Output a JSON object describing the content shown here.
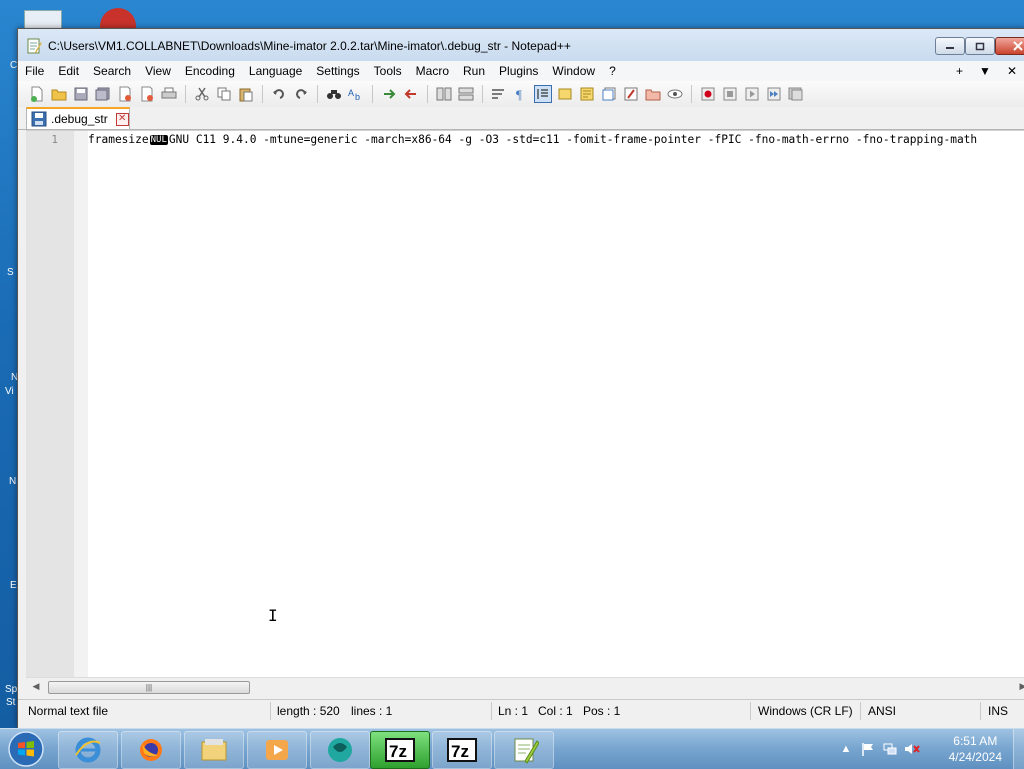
{
  "window": {
    "title": "C:\\Users\\VM1.COLLABNET\\Downloads\\Mine-imator 2.0.2.tar\\Mine-imator\\.debug_str - Notepad++"
  },
  "menu": {
    "items": [
      "File",
      "Edit",
      "Search",
      "View",
      "Encoding",
      "Language",
      "Settings",
      "Tools",
      "Macro",
      "Run",
      "Plugins",
      "Window",
      "?"
    ],
    "right": [
      "+",
      "▼",
      "✕"
    ]
  },
  "tab": {
    "label": ".debug_str",
    "close": "✕"
  },
  "editor": {
    "line_number": "1",
    "text_before": "framesize",
    "control_char": "NUL",
    "text_after": "GNU C11 9.4.0 -mtune=generic -march=x86-64 -g -O3 -std=c11 -fomit-frame-pointer -fPIC -fno-math-errno -fno-trapping-math"
  },
  "statusbar": {
    "file_type": "Normal text file",
    "length": "length : 520",
    "lines": "lines : 1",
    "ln": "Ln : 1",
    "col": "Col : 1",
    "pos": "Pos : 1",
    "eol": "Windows (CR LF)",
    "encoding": "ANSI",
    "mode": "INS"
  },
  "taskbar": {
    "time": "6:51 AM",
    "date": "4/24/2024",
    "apps": [
      "internet-explorer",
      "firefox",
      "file-explorer",
      "media-player",
      "app-teal",
      "7zip",
      "7zip",
      "notepad-plus-plus"
    ]
  },
  "desktop": {
    "fragments": [
      "S",
      "N",
      "Vi",
      "N",
      "E",
      "Sp",
      "St",
      "C"
    ]
  },
  "colors": {
    "tab_accent": "#f5a623",
    "taskbar_active": "#2ea02e",
    "desktop": "#1a6bb5"
  }
}
